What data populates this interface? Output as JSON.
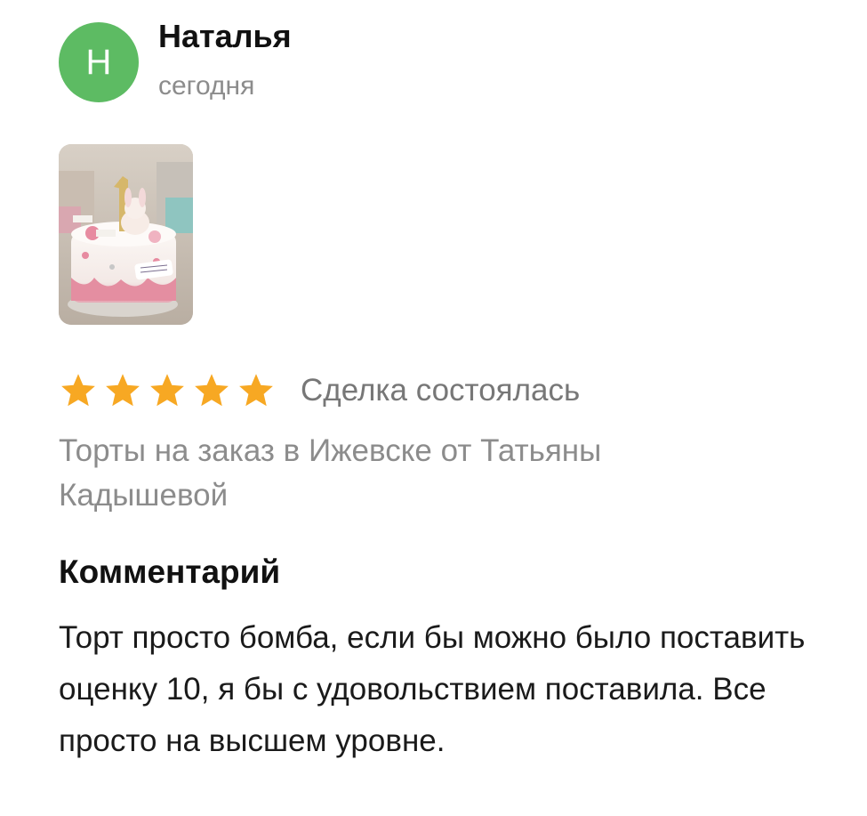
{
  "author": {
    "initial": "Н",
    "name": "Наталья",
    "date": "сегодня",
    "avatar_color": "#5dbb63"
  },
  "photo": {
    "alt": "Торт"
  },
  "rating": {
    "stars": 5,
    "max_stars": 5,
    "star_color": "#f7a823",
    "status": "Сделка состоялась"
  },
  "listing": {
    "title": "Торты на заказ в Ижевске от Татьяны Кадышевой"
  },
  "comment": {
    "heading": "Комментарий",
    "text": "Торт просто бомба, если бы можно было поставить оценку 10, я бы с удовольствием поставила. Все просто на высшем уровне."
  }
}
